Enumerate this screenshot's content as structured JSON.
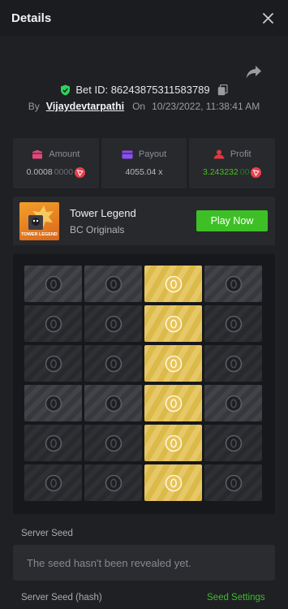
{
  "header": {
    "title": "Details",
    "close_icon": "close-icon"
  },
  "share_icon": "share-icon",
  "bet": {
    "id_label": "Bet ID: 86243875311583789",
    "by_label": "By",
    "user": "Vijaydevtarpathi",
    "on_label": "On",
    "date": "10/23/2022, 11:38:41 AM",
    "shield_color": "#2ed15b"
  },
  "stats": {
    "amount": {
      "label": "Amount",
      "value_main": "0.0008",
      "value_dim": "0000"
    },
    "payout": {
      "label": "Payout",
      "value": "4055.04 x"
    },
    "profit": {
      "label": "Profit",
      "value_main": "3.243232",
      "value_dim": "00"
    }
  },
  "game": {
    "name": "Tower Legend",
    "provider": "BC Originals",
    "thumb_text": "TOWER LEGEND",
    "play_label": "Play Now",
    "accent": "#3dc025"
  },
  "board": {
    "rows": [
      [
        "light",
        "light",
        "gold",
        "light"
      ],
      [
        "dark",
        "dark",
        "gold",
        "dark"
      ],
      [
        "dark",
        "dark",
        "gold",
        "dark"
      ],
      [
        "light",
        "light",
        "gold",
        "light"
      ],
      [
        "dark",
        "dark",
        "gold",
        "dark"
      ],
      [
        "dark",
        "dark",
        "gold",
        "dark"
      ]
    ]
  },
  "seed": {
    "server_seed_label": "Server Seed",
    "server_seed_placeholder": "The seed hasn't been revealed yet.",
    "hash_label": "Server Seed (hash)",
    "settings_label": "Seed Settings"
  }
}
